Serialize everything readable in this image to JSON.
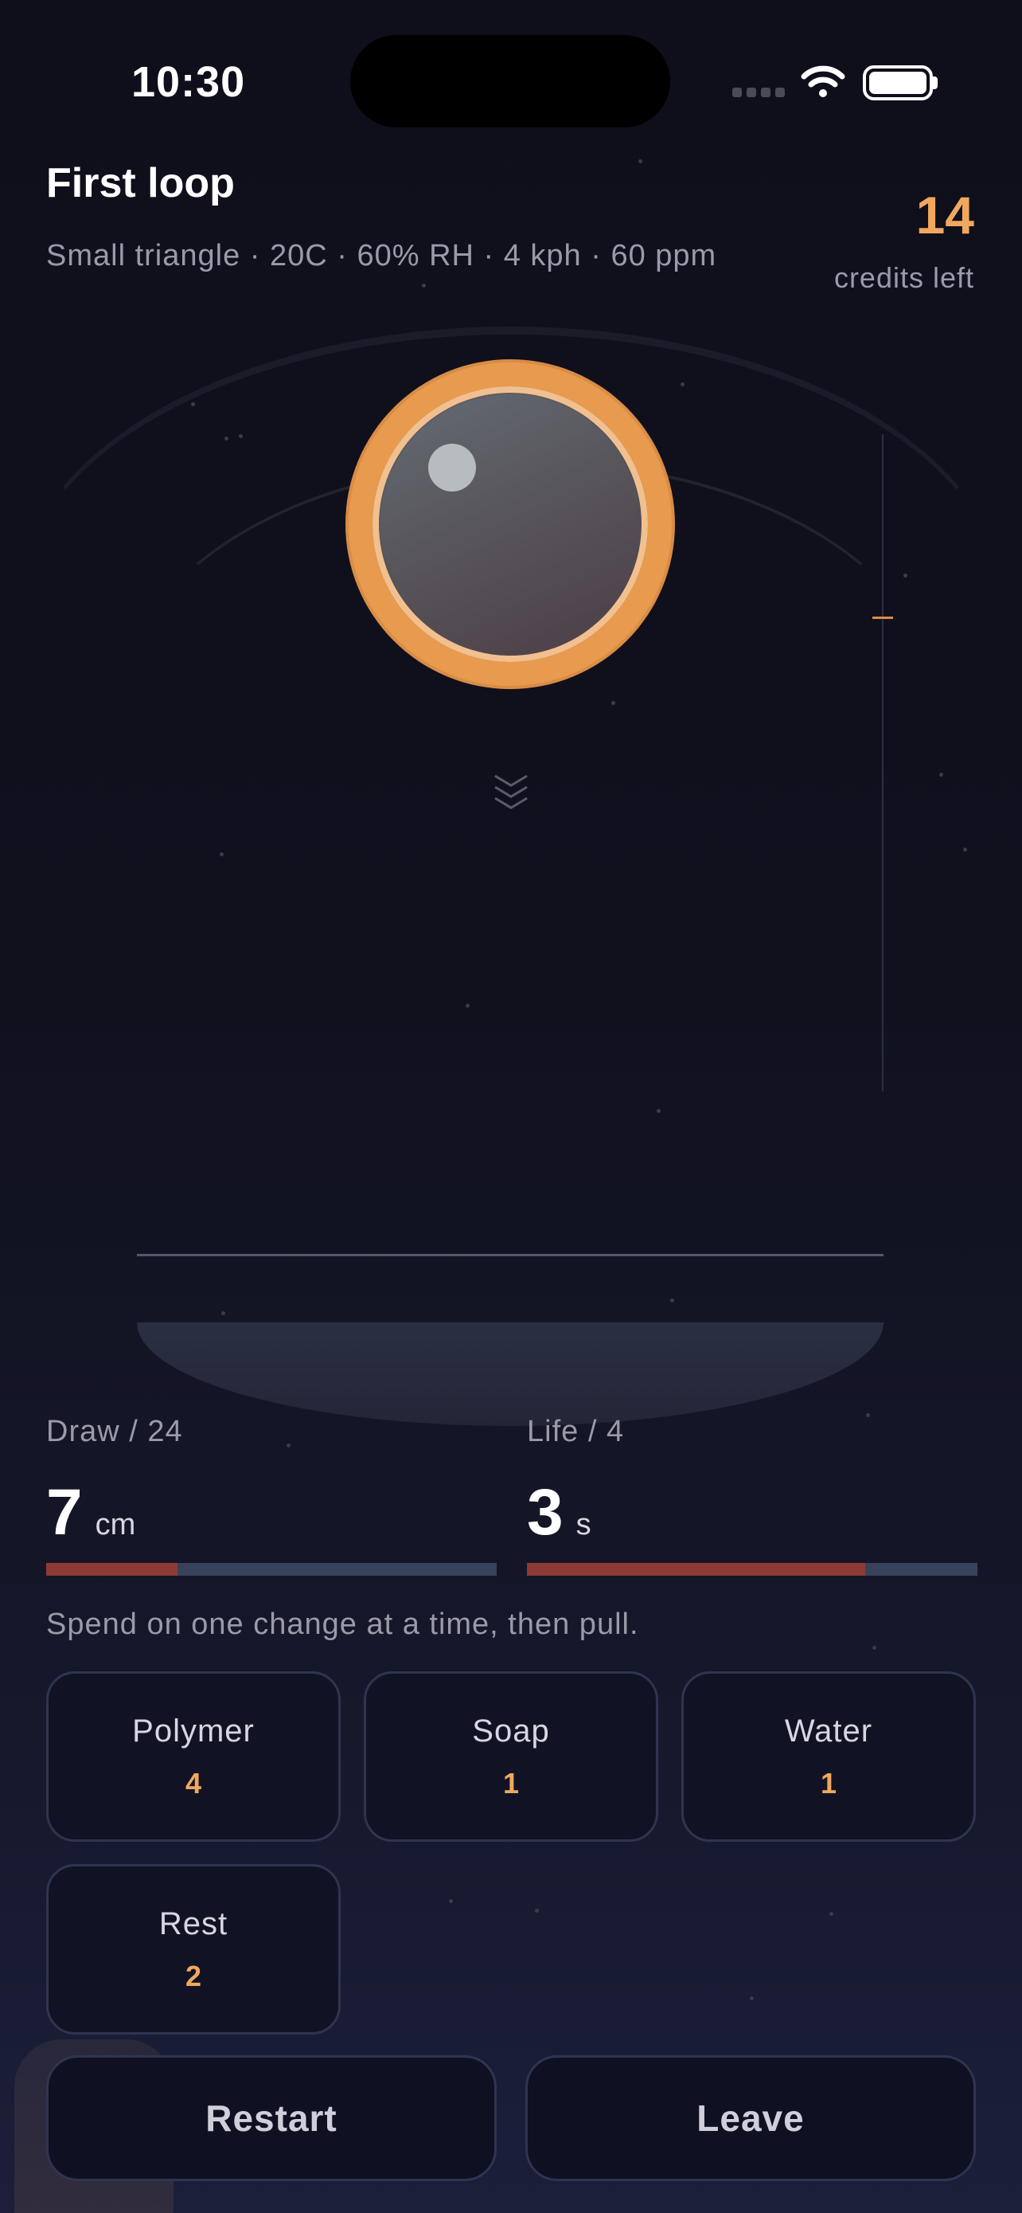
{
  "status_bar": {
    "time": "10:30"
  },
  "header": {
    "title": "First loop",
    "subtitle": "Small triangle  ·  20C  ·  60% RH  ·  4 kph  ·  60 ppm",
    "credits_value": "14",
    "credits_label": "credits left"
  },
  "stats": {
    "draw": {
      "label": "Draw / 24",
      "value": "7",
      "unit": "cm",
      "max": 24,
      "current": 7
    },
    "life": {
      "label": "Life / 4",
      "value": "3",
      "unit": "s",
      "max": 4,
      "current": 3
    }
  },
  "hint": "Spend on one change at a time, then pull.",
  "choices": [
    {
      "name": "Polymer",
      "cost": "4"
    },
    {
      "name": "Soap",
      "cost": "1"
    },
    {
      "name": "Water",
      "cost": "1"
    },
    {
      "name": "Rest",
      "cost": "2"
    }
  ],
  "actions": {
    "restart": "Restart",
    "leave": "Leave"
  },
  "colors": {
    "accent": "#f0a85f",
    "bubble_ring": "#e89a4f",
    "bar_fill": "#8e3b35",
    "bar_track": "#39425b",
    "background": "#0f0f1b"
  },
  "icons": [
    "wifi-icon",
    "battery-icon",
    "cellular-signal-icon",
    "chevrons-down-icon"
  ]
}
